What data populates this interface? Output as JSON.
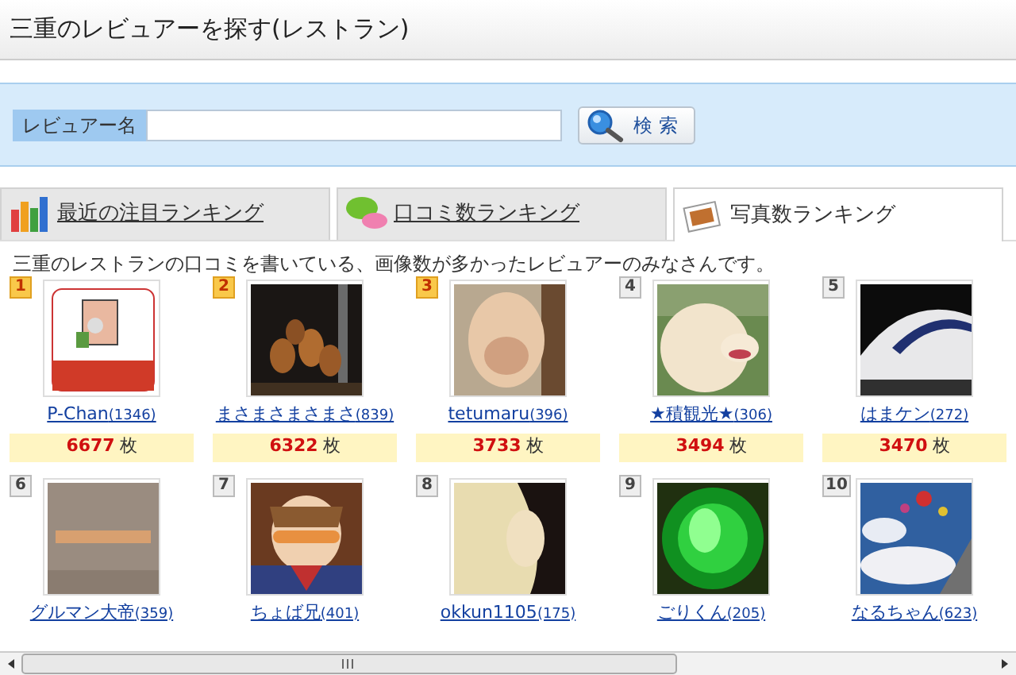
{
  "header": {
    "title": "三重のレビュアーを探す(レストラン)"
  },
  "search": {
    "label": "レビュアー名",
    "button": "検 索"
  },
  "tabs": [
    {
      "label": "最近の注目ランキング",
      "selected": false
    },
    {
      "label": "口コミ数ランキング",
      "selected": false
    },
    {
      "label": "写真数ランキング",
      "selected": true
    }
  ],
  "description": "三重のレストランの口コミを書いている、画像数が多かったレビュアーのみなさんです。",
  "reviewers": [
    {
      "rank": "1",
      "top": true,
      "name": "P-Chan",
      "reviews": "(1346)",
      "photos": "6677",
      "unit": "枚"
    },
    {
      "rank": "2",
      "top": true,
      "name": "まさまさまさまさ",
      "reviews": "(839)",
      "photos": "6322",
      "unit": "枚"
    },
    {
      "rank": "3",
      "top": true,
      "name": "tetumaru",
      "reviews": "(396)",
      "photos": "3733",
      "unit": "枚"
    },
    {
      "rank": "4",
      "top": false,
      "name": "★積観光★",
      "reviews": "(306)",
      "photos": "3494",
      "unit": "枚"
    },
    {
      "rank": "5",
      "top": false,
      "name": "はまケン",
      "reviews": "(272)",
      "photos": "3470",
      "unit": "枚"
    },
    {
      "rank": "6",
      "top": false,
      "name": "グルマン大帝",
      "reviews": "(359)"
    },
    {
      "rank": "7",
      "top": false,
      "name": "ちょば兄",
      "reviews": "(401)"
    },
    {
      "rank": "8",
      "top": false,
      "name": "okkun1105",
      "reviews": "(175)"
    },
    {
      "rank": "9",
      "top": false,
      "name": "ごりくん",
      "reviews": "(205)"
    },
    {
      "rank": "10",
      "top": false,
      "name": "なるちゃん",
      "reviews": "(623)"
    }
  ]
}
